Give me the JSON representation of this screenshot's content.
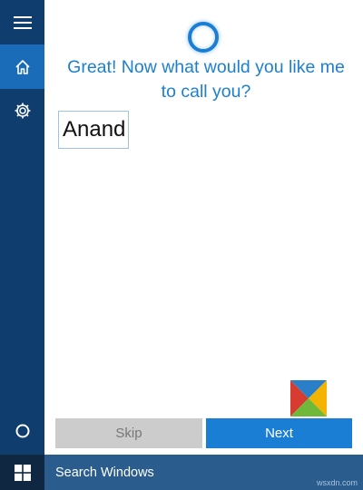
{
  "sidebar": {
    "items": [
      {
        "name": "menu",
        "icon": "hamburger-menu-icon"
      },
      {
        "name": "home",
        "icon": "home-icon",
        "selected": true
      },
      {
        "name": "settings",
        "icon": "gear-icon"
      },
      {
        "name": "cortana",
        "icon": "cortana-circle-icon"
      }
    ]
  },
  "main": {
    "prompt": "Great! Now what would you like me to call you?",
    "name_value": "Anand",
    "skip_label": "Skip",
    "next_label": "Next"
  },
  "taskbar": {
    "search_placeholder": "Search Windows",
    "watermark": "wsxdn.com"
  },
  "colors": {
    "sidebar": "#0f3d6e",
    "accent": "#1a7fd4",
    "taskbar": "#1b3e62"
  }
}
